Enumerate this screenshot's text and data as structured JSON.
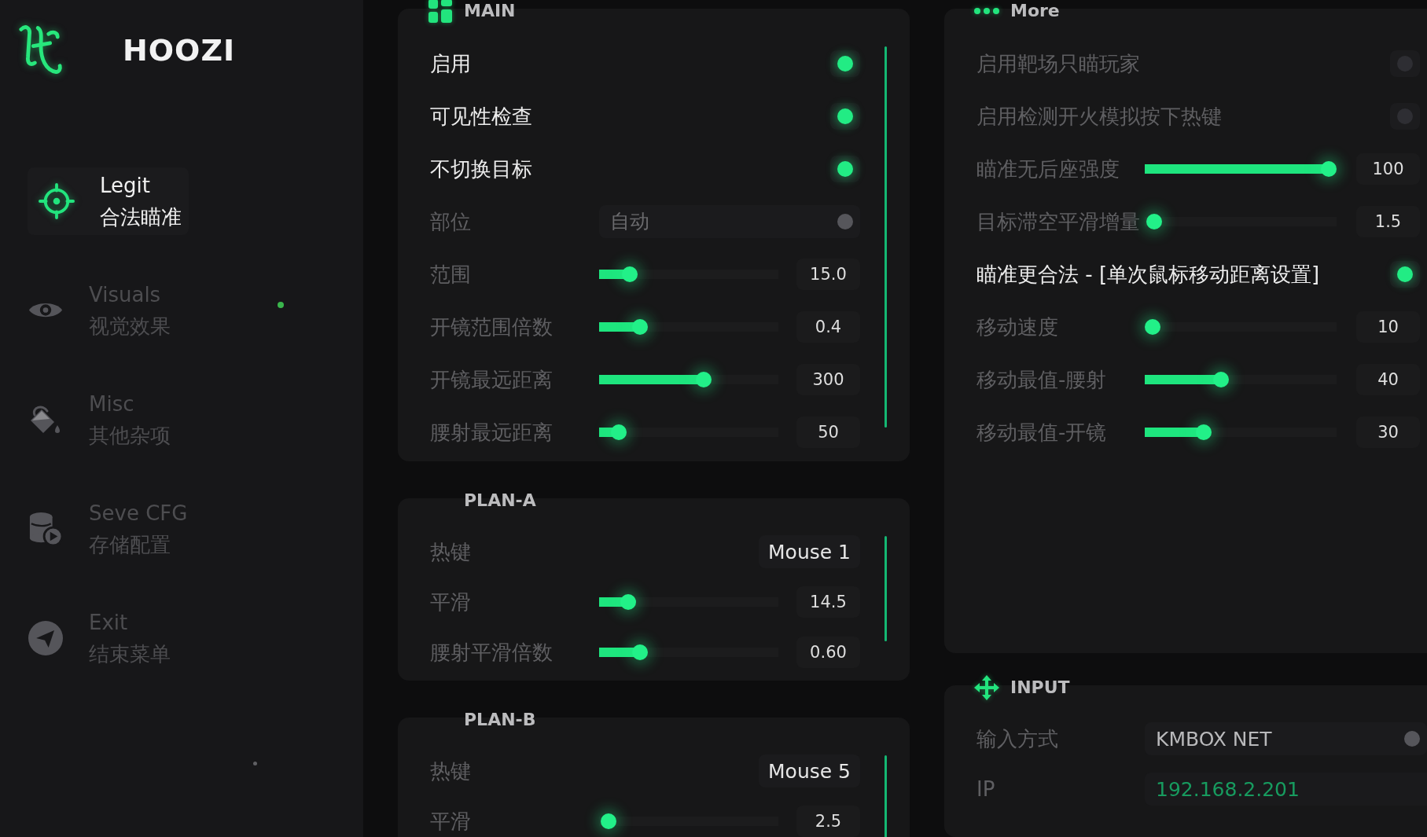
{
  "sidebar": {
    "brand": "HOOZI",
    "items": [
      {
        "label": "Legit",
        "sublabel": "合法瞄准",
        "selected": true,
        "indicator": false
      },
      {
        "label": "Visuals",
        "sublabel": "视觉效果",
        "selected": false,
        "indicator": true
      },
      {
        "label": "Misc",
        "sublabel": "其他杂项",
        "selected": false,
        "indicator": false
      },
      {
        "label": "Seve CFG",
        "sublabel": "存储配置",
        "selected": false,
        "indicator": false
      },
      {
        "label": "Exit",
        "sublabel": "结束菜单",
        "selected": false,
        "indicator": false
      }
    ]
  },
  "columns": [
    {
      "panels": [
        {
          "title": "MAIN",
          "rows": [
            {
              "kind": "toggle",
              "label": "启用",
              "on": true
            },
            {
              "kind": "toggle",
              "label": "可见性检查",
              "on": true
            },
            {
              "kind": "toggle",
              "label": "不切换目标",
              "on": true
            },
            {
              "kind": "select",
              "label": "部位",
              "value": "自动",
              "disabled": true
            },
            {
              "kind": "slider",
              "label": "范围",
              "level": 0.14,
              "reading": "15.0"
            },
            {
              "kind": "slider",
              "label": "开镜范围倍数",
              "level": 0.2,
              "reading": "0.4"
            },
            {
              "kind": "slider",
              "label": "开镜最远距离",
              "level": 0.59,
              "reading": "300"
            },
            {
              "kind": "slider",
              "label": "腰射最远距离",
              "level": 0.07,
              "reading": "50"
            }
          ]
        },
        {
          "title": "PLAN-A",
          "rows": [
            {
              "kind": "hotkey",
              "label": "热键",
              "value": "Mouse 1"
            },
            {
              "kind": "slider",
              "label": "平滑",
              "level": 0.13,
              "reading": "14.5"
            },
            {
              "kind": "slider",
              "label": "腰射平滑倍数",
              "level": 0.2,
              "reading": "0.60"
            }
          ]
        },
        {
          "title": "PLAN-B",
          "rows": [
            {
              "kind": "hotkey",
              "label": "热键",
              "value": "Mouse 5"
            },
            {
              "kind": "slider",
              "label": "平滑",
              "level": 0.01,
              "reading": "2.5"
            }
          ]
        }
      ]
    },
    {
      "panels": [
        {
          "title": "More",
          "rows": [
            {
              "kind": "toggle",
              "label": "启用靶场只瞄玩家",
              "on": false
            },
            {
              "kind": "toggle",
              "label": "启用检测开火模拟按下热键",
              "on": false
            },
            {
              "kind": "slider",
              "label": "瞄准无后座强度",
              "level": 1.0,
              "reading": "100"
            },
            {
              "kind": "slider",
              "label": "目标滞空平滑增量",
              "level": 0.01,
              "reading": "1.5"
            },
            {
              "kind": "toggle",
              "label": "瞄准更合法 - [单次鼠标移动距离设置]",
              "on": true
            },
            {
              "kind": "slider",
              "label": "移动速度",
              "level": 0.0,
              "reading": "10"
            },
            {
              "kind": "slider",
              "label": "移动最值-腰射",
              "level": 0.39,
              "reading": "40"
            },
            {
              "kind": "slider",
              "label": "移动最值-开镜",
              "level": 0.29,
              "reading": "30"
            }
          ]
        },
        {
          "title": "INPUT",
          "rows": [
            {
              "kind": "select",
              "label": "输入方式",
              "value": "KMBOX NET",
              "disabled": false
            },
            {
              "kind": "field",
              "label": "IP",
              "value": "192.168.2.201"
            }
          ]
        }
      ]
    }
  ]
}
